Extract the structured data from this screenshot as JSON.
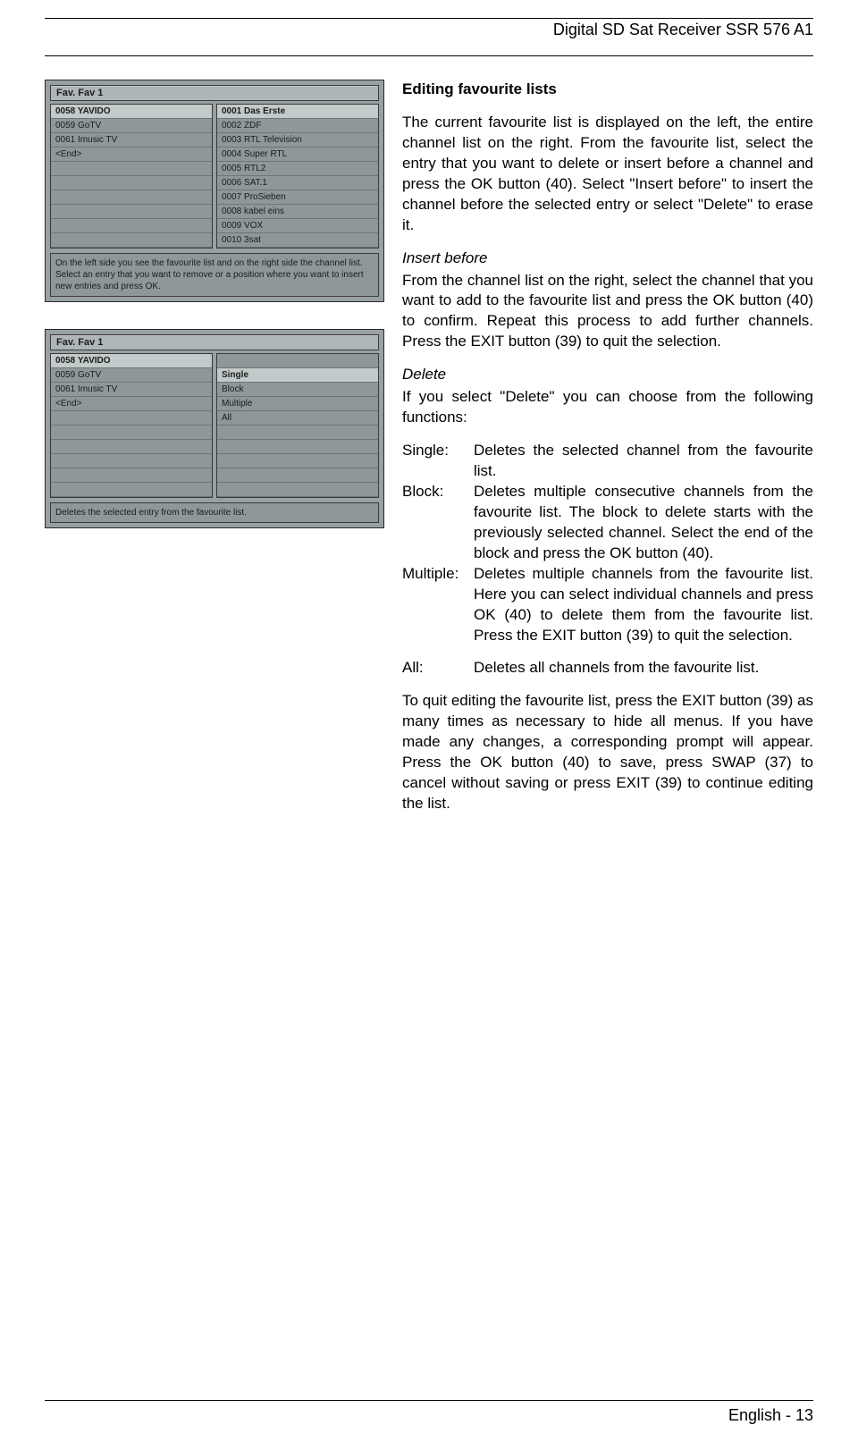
{
  "header": {
    "title": "Digital SD Sat Receiver SSR 576 A1"
  },
  "screenshot1": {
    "titlebar": "Fav. Fav 1",
    "left_list": [
      {
        "text": "0058 YAVIDO",
        "hl": true
      },
      {
        "text": "0059 GoTV",
        "hl": false
      },
      {
        "text": "0061 Imusic TV",
        "hl": false
      },
      {
        "text": "<End>",
        "hl": false
      }
    ],
    "left_blanks": 6,
    "right_list": [
      {
        "text": "0001 Das Erste",
        "hl": true
      },
      {
        "text": "0002 ZDF",
        "hl": false
      },
      {
        "text": "0003 RTL Television",
        "hl": false
      },
      {
        "text": "0004 Super RTL",
        "hl": false
      },
      {
        "text": "0005 RTL2",
        "hl": false
      },
      {
        "text": "0006 SAT.1",
        "hl": false
      },
      {
        "text": "0007 ProSieben",
        "hl": false
      },
      {
        "text": "0008 kabel eins",
        "hl": false
      },
      {
        "text": "0009 VOX",
        "hl": false
      },
      {
        "text": "0010 3sat",
        "hl": false
      }
    ],
    "caption": "On the left side you see the favourite list and on the right side the channel list. Select an entry that you want to remove or a position where you want to insert new entries and press OK."
  },
  "screenshot2": {
    "titlebar": "Fav. Fav 1",
    "left_list": [
      {
        "text": "0058 YAVIDO",
        "hl": true
      },
      {
        "text": "0059 GoTV",
        "hl": false
      },
      {
        "text": "0061 Imusic TV",
        "hl": false
      },
      {
        "text": "<End>",
        "hl": false
      }
    ],
    "left_blanks": 6,
    "right_top_blanks": 1,
    "right_list": [
      {
        "text": "Single",
        "hl": true
      },
      {
        "text": "Block",
        "hl": false
      },
      {
        "text": "Multiple",
        "hl": false
      },
      {
        "text": "All",
        "hl": false
      }
    ],
    "right_bottom_blanks": 5,
    "caption": "Deletes the selected entry from the favourite list."
  },
  "content": {
    "heading": "Editing favourite lists",
    "p1": "The current favourite list is displayed on the left, the entire channel list on the right. From the favourite list, select the entry that you want to delete or insert before a channel and press the OK button (40). Select \"Insert before\" to insert the channel before the selected entry or select \"Delete\" to erase it.",
    "h_insert": "Insert before",
    "p_insert": "From the channel list on the right, select the channel that you want to add to the favourite list and press the OK button (40) to confirm. Repeat this process to add further channels. Press the EXIT button (39) to quit the selection.",
    "h_delete": "Delete",
    "p_delete": "If you select \"Delete\" you can choose from the following functions:",
    "defs": [
      {
        "label": "Single:",
        "body": "Deletes the selected channel from the favourite list."
      },
      {
        "label": "Block:",
        "body": "Deletes multiple consecutive channels from the favourite list. The block to delete starts with the previously selected channel. Select the end of the block and press the OK button (40)."
      },
      {
        "label": "Multiple:",
        "body": "Deletes multiple channels from the favourite list. Here you can select individual channels and press OK (40) to delete them from the favourite list. Press the EXIT button (39) to quit the selection."
      },
      {
        "label": "All:",
        "body": "Deletes all channels from the favourite list."
      }
    ],
    "p_last": "To quit editing the favourite list, press the EXIT button (39) as many times as necessary to hide all menus. If you have made any changes, a corresponding prompt will appear. Press the OK button (40) to save, press SWAP (37) to cancel without saving or press EXIT (39) to continue editing the list."
  },
  "footer": {
    "text": "English - 13"
  }
}
